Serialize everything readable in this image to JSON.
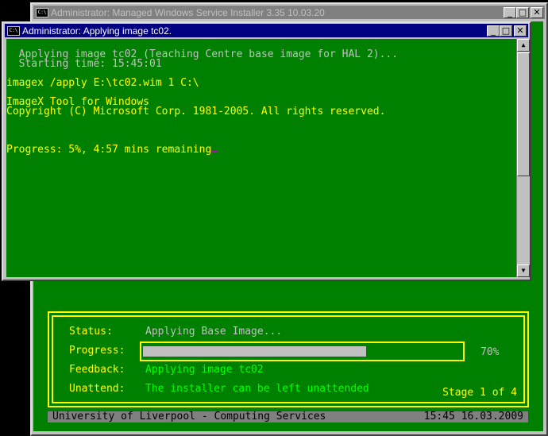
{
  "back_window": {
    "title": "Administrator:  Managed Windows Service Installer 3.35 10.03.20"
  },
  "front_window": {
    "title": "Administrator:  Applying image tc02."
  },
  "window_buttons": {
    "minimize": "_",
    "maximize": "□",
    "close": "✕"
  },
  "console": {
    "lines": [
      {
        "text": "  Applying image tc02 (Teaching Centre base image for HAL 2)...",
        "color": "gray"
      },
      {
        "text": "  Starting time: 15:45:01",
        "color": "gray"
      },
      {
        "text": "",
        "color": "gray"
      },
      {
        "text": "imagex /apply E:\\tc02.wim 1 C:\\",
        "color": "yellow"
      },
      {
        "text": "",
        "color": "gray"
      },
      {
        "text": "ImageX Tool for Windows",
        "color": "yellow"
      },
      {
        "text": "Copyright (C) Microsoft Corp. 1981-2005. All rights reserved.",
        "color": "yellow"
      },
      {
        "text": "",
        "color": "gray"
      },
      {
        "text": "",
        "color": "gray"
      },
      {
        "text": "",
        "color": "gray"
      }
    ],
    "progress_line": "Progress: 5%, 4:57 mins remaining"
  },
  "installer": {
    "status_label": "Status:",
    "status_value": "Applying Base Image...",
    "progress_label": "Progress:",
    "progress_percent": 70,
    "progress_text": "70%",
    "feedback_label": "Feedback:",
    "feedback_value": "Applying image tc02",
    "unattend_label": "Unattend:",
    "unattend_value": "The installer can be left unattended",
    "stage": "Stage 1 of 4"
  },
  "status_bar": {
    "left": "University of Liverpool - Computing Services",
    "right": "15:45 16.03.2009"
  },
  "colors": {
    "console_bg": "#008000",
    "accent": "#ffff00",
    "active_title": "#000080"
  }
}
